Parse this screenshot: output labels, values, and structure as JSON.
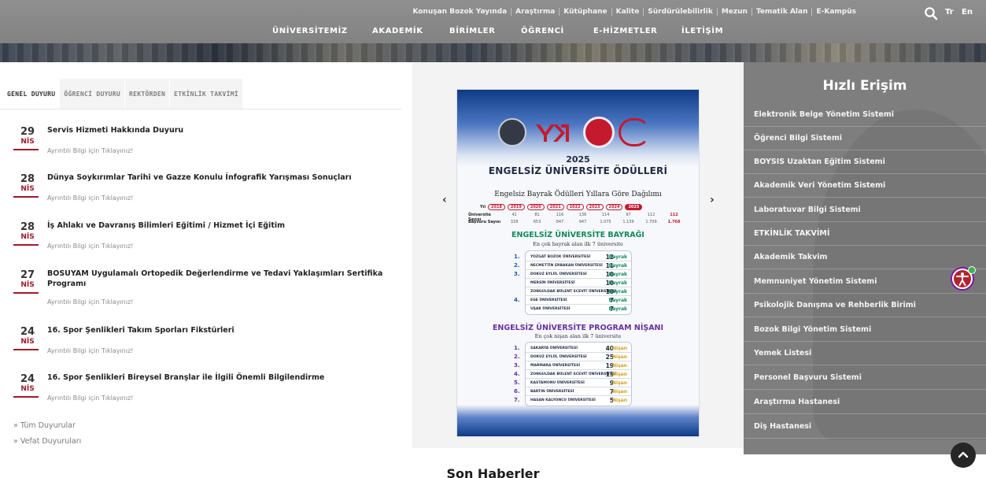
{
  "header": {
    "top_links": [
      "Konuşan Bozok Yayında",
      "Araştırma",
      "Kütüphane",
      "Kalite",
      "Sürdürülebilirlik",
      "Mezun",
      "Tematik Alan",
      "E-Kampüs"
    ],
    "lang_tr": "Tr",
    "lang_en": "En",
    "main_nav": [
      "ÜNİVERSİTEMİZ",
      "AKADEMİK",
      "BİRİMLER",
      "ÖĞRENCİ",
      "E-HİZMETLER",
      "İLETİŞİM"
    ]
  },
  "tabs": [
    "GENEL DUYURU",
    "ÖĞRENCİ DUYURU",
    "REKTÖRDEN",
    "ETKİNLİK TAKVİMİ"
  ],
  "announcements": [
    {
      "day": "29",
      "month": "NİS",
      "title": "Servis Hizmeti Hakkında Duyuru",
      "more": "Ayrıntılı Bilgi için Tıklayınız!"
    },
    {
      "day": "28",
      "month": "NİS",
      "title": "Dünya Soykırımlar Tarihi ve Gazze Konulu İnfografik Yarışması Sonuçları",
      "more": "Ayrıntılı Bilgi için Tıklayınız!"
    },
    {
      "day": "28",
      "month": "NİS",
      "title": "İş Ahlakı ve Davranış Bilimleri Eğitimi / Hizmet İçi Eğitim",
      "more": "Ayrıntılı Bilgi için Tıklayınız!"
    },
    {
      "day": "27",
      "month": "NİS",
      "title": "BOSUYAM Uygulamalı Ortopedik Değerlendirme ve Tedavi Yaklaşımları Sertifika Programı",
      "more": "Ayrıntılı Bilgi için Tıklayınız!"
    },
    {
      "day": "24",
      "month": "NİS",
      "title": "16. Spor Şenlikleri Takım Sporları Fikstürleri",
      "more": "Ayrıntılı Bilgi için Tıklayınız!"
    },
    {
      "day": "24",
      "month": "NİS",
      "title": "16. Spor Şenlikleri Bireysel Branşlar ile İlgili Önemli Bilgilendirme",
      "more": "Ayrıntılı Bilgi için Tıklayınız!"
    }
  ],
  "footer_links": [
    "» Tüm Duyurular",
    "» Vefat Duyuruları"
  ],
  "slider": {
    "prev": "‹",
    "next": "›",
    "poster": {
      "year": "2025",
      "title": "ENGELSİZ ÜNİVERSİTE ÖDÜLLERİ",
      "subtitle": "Engelsiz Bayrak Ödülleri Yıllara Göre Dağılımı",
      "year_label": "Yıl",
      "years": [
        "2018",
        "2019",
        "2020",
        "2021",
        "2022",
        "2023",
        "2024",
        "2025"
      ],
      "universities_label": "Üniversite Sayısı",
      "universities": [
        "41",
        "81",
        "116",
        "136",
        "114",
        "97",
        "112",
        "112"
      ],
      "applications_label": "Başvuru Sayısı",
      "applications": [
        "318",
        "653",
        "847",
        "947",
        "1.075",
        "1.139",
        "1.709",
        "1.768"
      ],
      "flag_title": "ENGELSİZ ÜNİVERSİTE BAYRAĞI",
      "flag_sub": "En çok bayrak alan ilk 7 üniversite",
      "flag_rows": [
        {
          "rank": "1.",
          "name": "YOZGAT BOZOK ÜNİVERSİTESİ",
          "value": "12"
        },
        {
          "rank": "2.",
          "name": "NECMETTİN ERBAKAN ÜNİVERSİTESİ",
          "value": "11"
        },
        {
          "rank": "3.",
          "name": "DOKUZ EYLÜL ÜNİVERSİTESİ",
          "value": "10"
        },
        {
          "rank": "",
          "name": "MERSİN ÜNİVERSİTESİ",
          "value": "10"
        },
        {
          "rank": "",
          "name": "ZONGULDAK BÜLENT ECEVİT ÜNİVERSİTESİ",
          "value": "10"
        },
        {
          "rank": "4.",
          "name": "EGE ÜNİVERSİTESİ",
          "value": "7"
        },
        {
          "rank": "",
          "name": "UŞAK ÜNİVERSİTESİ",
          "value": "7"
        }
      ],
      "flag_mark": "Bayrak",
      "badge_title": "ENGELSİZ ÜNİVERSİTE PROGRAM NİŞANI",
      "badge_sub": "En çok nişan alan ilk 7 üniversite",
      "badge_rows": [
        {
          "rank": "1.",
          "name": "SAKARYA ÜNİVERSİTESİ",
          "value": "40"
        },
        {
          "rank": "2.",
          "name": "DOKUZ EYLÜL ÜNİVERSİTESİ",
          "value": "25"
        },
        {
          "rank": "3.",
          "name": "MARMARA ÜNİVERSİTESİ",
          "value": "19"
        },
        {
          "rank": "4.",
          "name": "ZONGULDAK BÜLENT ECEVİT ÜNİVERSİTESİ",
          "value": "15"
        },
        {
          "rank": "5.",
          "name": "KASTAMONU ÜNİVERSİTESİ",
          "value": "9"
        },
        {
          "rank": "6.",
          "name": "BARTIN ÜNİVERSİTESİ",
          "value": "7"
        },
        {
          "rank": "7.",
          "name": "HASAN KALYONCU ÜNİVERSİTESİ",
          "value": "5"
        }
      ],
      "badge_mark": "Nişan"
    }
  },
  "quick_access": {
    "title": "Hızlı Erişim",
    "items": [
      "Elektronik Belge Yönetim Sistemi",
      "Öğrenci Bilgi Sistemi",
      "BOYSIS Uzaktan Eğitim Sistemi",
      "Akademik Veri Yönetim Sistemi",
      "Laboratuvar Bilgi Sistemi",
      "ETKİNLİK TAKVİMİ",
      "Akademik Takvim",
      "Memnuniyet Yönetim Sistemi",
      "Psikolojik Danışma ve Rehberlik Birimi",
      "Bozok Bilgi Yönetim Sistemi",
      "Yemek Listesi",
      "Personel Başvuru Sistemi",
      "Araştırma Hastanesi",
      "Diş Hastanesi"
    ]
  },
  "section_heading": "Son Haberler",
  "colors": {
    "accent": "#9b1c2c",
    "header_bg": "#858585",
    "quick_bg": "#7e7e7e"
  }
}
